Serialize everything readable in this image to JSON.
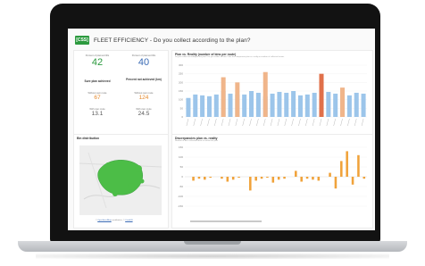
{
  "dashboard": {
    "logo_text": "[CSS]",
    "title": "FLEET EFFICIENCY - Do you collect according to the plan?",
    "brand_color": "#2c9a3f"
  },
  "kpis": {
    "col1_label": "Percent of planned lifts",
    "col1_value": "42",
    "col1_color": "#2c9a3f",
    "col2_label": "Percent of planned lifts",
    "col2_value": "40",
    "col2_color": "#3b6bb5",
    "left_header": "Sure plan achieved",
    "right_header": "Percent not achieved (km)",
    "left_sub_label": "Without own route",
    "left_sub_value": "67",
    "right_sub_label": "Without own route",
    "right_sub_value": "124",
    "left_bottom_label": "With own route",
    "left_bottom_value": "13.1",
    "right_bottom_label": "With own route",
    "right_bottom_value": "24.5",
    "accent_color": "#e58a2e"
  },
  "bin_map": {
    "title": "Bin distribution",
    "credit_link1": "OpenStreetMap",
    "credit_mid": "contributors, ©",
    "credit_link2": "CartoDB"
  },
  "chart_plan": {
    "title": "Plan vs. Reality (number of bins per route)",
    "subtitle": "Do you collect according to the plan? Do you collect all bins? See the comparison plan vs. reality in number of collected routes"
  },
  "chart_discrepancy": {
    "title": "Discrepancies plan vs. reality",
    "subtitle": "Number of bins collected above or below the plan"
  },
  "chart_data": [
    {
      "type": "bar",
      "title": "Plan vs. Reality (number of bins per route)",
      "yticks": [
        "300",
        "250",
        "200",
        "150",
        "100",
        "50",
        "0"
      ],
      "ylim": [
        0,
        300
      ],
      "series": [
        {
          "name": "",
          "color": "#9cc5ea",
          "values": [
            110,
            130,
            125,
            120,
            130,
            150,
            135,
            130,
            130,
            150,
            140,
            120,
            135,
            145,
            140,
            150,
            125,
            130,
            140,
            150,
            145,
            135,
            130,
            125,
            140,
            135
          ]
        },
        {
          "name": "",
          "color": "#f0b58a",
          "values": [
            0,
            0,
            0,
            0,
            0,
            230,
            0,
            200,
            0,
            0,
            0,
            260,
            0,
            0,
            0,
            0,
            0,
            0,
            0,
            210,
            0,
            0,
            170,
            0,
            0,
            0
          ]
        },
        {
          "name": "",
          "color": "#e0704a",
          "values": [
            0,
            0,
            0,
            0,
            0,
            0,
            0,
            0,
            0,
            0,
            0,
            0,
            0,
            0,
            0,
            0,
            0,
            0,
            0,
            250,
            0,
            0,
            0,
            0,
            0,
            0
          ]
        }
      ]
    },
    {
      "type": "bar",
      "title": "Discrepancies plan vs. reality",
      "yticks": [
        "150",
        "100",
        "50",
        "0",
        "-50",
        "-100",
        "-150"
      ],
      "ylim": [
        -150,
        150
      ],
      "series": [
        {
          "name": "",
          "color": "#f0a23a",
          "values": [
            0,
            -20,
            -10,
            -15,
            -5,
            0,
            -10,
            -25,
            -15,
            -5,
            0,
            -70,
            -20,
            -10,
            -5,
            -30,
            -15,
            -10,
            0,
            30,
            -25,
            -10,
            -15,
            -20,
            0,
            20,
            -60,
            80,
            130,
            -40,
            110,
            -10
          ]
        }
      ]
    }
  ]
}
